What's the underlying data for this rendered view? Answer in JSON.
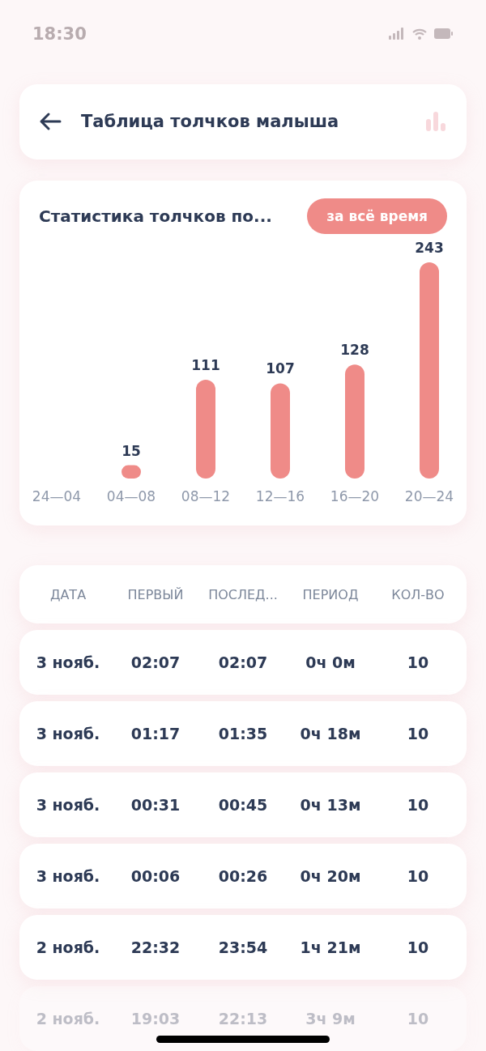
{
  "status_bar": {
    "time": "18:30"
  },
  "header": {
    "title": "Таблица толчков малыша"
  },
  "stats": {
    "title": "Статистика толчков по...",
    "filter": "за всё время",
    "chart_data": {
      "type": "bar",
      "categories": [
        "24—04",
        "04—08",
        "08—12",
        "12—16",
        "16—20",
        "20—24"
      ],
      "series": [
        {
          "color": "#ef8b88",
          "values": [
            null,
            15,
            111,
            107,
            128,
            243
          ]
        }
      ],
      "data_labels": true
    }
  },
  "table": {
    "columns": [
      "ДАТА",
      "ПЕРВЫЙ",
      "ПОСЛЕД...",
      "ПЕРИОД",
      "КОЛ-ВО"
    ],
    "rows": [
      {
        "cells": [
          "3 нояб.",
          "02:07",
          "02:07",
          "0ч 0м",
          "10"
        ],
        "faded": false
      },
      {
        "cells": [
          "3 нояб.",
          "01:17",
          "01:35",
          "0ч 18м",
          "10"
        ],
        "faded": false
      },
      {
        "cells": [
          "3 нояб.",
          "00:31",
          "00:45",
          "0ч 13м",
          "10"
        ],
        "faded": false
      },
      {
        "cells": [
          "3 нояб.",
          "00:06",
          "00:26",
          "0ч 20м",
          "10"
        ],
        "faded": false
      },
      {
        "cells": [
          "2 нояб.",
          "22:32",
          "23:54",
          "1ч 21м",
          "10"
        ],
        "faded": false
      },
      {
        "cells": [
          "2 нояб.",
          "19:03",
          "22:13",
          "3ч 9м",
          "10"
        ],
        "faded": true
      }
    ]
  }
}
